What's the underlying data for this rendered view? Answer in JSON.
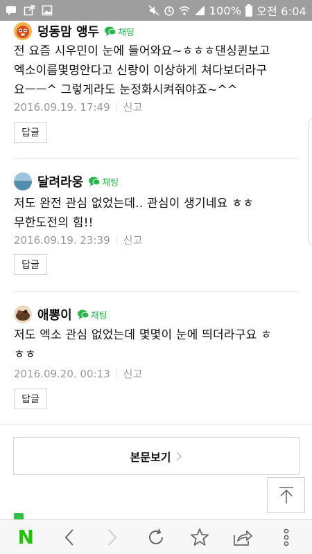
{
  "status_bar": {
    "battery_percent": "100%",
    "time": "오전 6:04",
    "icons": [
      "chat-bubble-icon",
      "share-box-icon",
      "image-icon",
      "mute-icon",
      "alarm-icon",
      "wifi-icon",
      "signal-icon",
      "battery-icon"
    ]
  },
  "comments": [
    {
      "author": "덩동맘 앵두",
      "chat_label": "채팅",
      "lines": [
        "전 요즘 시우민이 눈에 들어와요~ㅎㅎㅎ댄싱퀸보고",
        "엑소이름몇명안다고 신랑이 이상하게 쳐다보더라구",
        "요ㅡㅡ^ 그렇게라도 눈정화시켜줘야죠~^^"
      ],
      "date": "2016.09.19. 17:49",
      "report": "신고",
      "reply": "답글"
    },
    {
      "author": "달려라웅",
      "chat_label": "채팅",
      "lines": [
        "저도 완전 관심 없었는데.. 관심이 생기네요 ㅎㅎ",
        "무한도전의 힘!!"
      ],
      "date": "2016.09.19. 23:39",
      "report": "신고",
      "reply": "답글"
    },
    {
      "author": "애뽕이",
      "chat_label": "채팅",
      "lines": [
        "저도 엑소 관심 없었는데 몇몇이 눈에 띄더라구요 ㅎ",
        "ㅎㅎ"
      ],
      "date": "2016.09.20. 00:13",
      "report": "신고",
      "reply": "답글"
    }
  ],
  "view_article_label": "본문보기",
  "toolbar": {
    "icons": [
      "naver-home-icon",
      "back-icon",
      "forward-icon",
      "refresh-icon",
      "bookmark-star-icon",
      "share-icon",
      "more-menu-icon"
    ],
    "naver_letter": "N"
  },
  "colors": {
    "status_bar": "#9e9e9e",
    "chat_green": "#20b94a",
    "naver_green": "#1ec800",
    "meta_gray": "#999999"
  }
}
